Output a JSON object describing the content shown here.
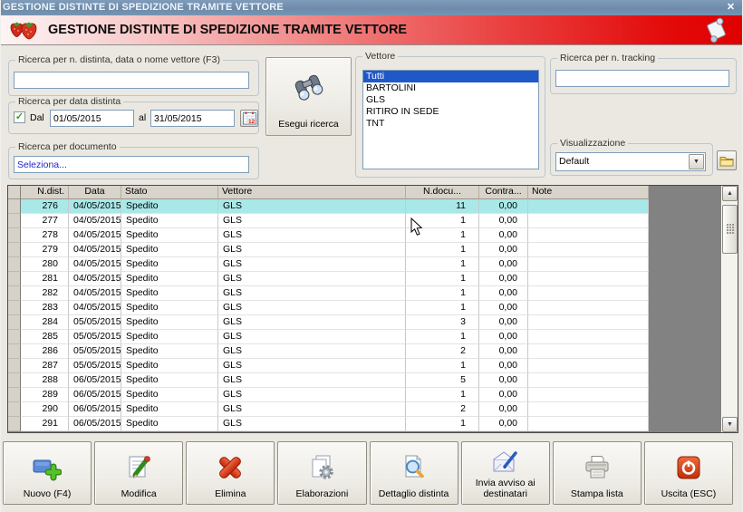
{
  "titlebar": {
    "title": "GESTIONE DISTINTE DI SPEDIZIONE TRAMITE VETTORE",
    "close_glyph": "✕"
  },
  "header": {
    "title": "GESTIONE DISTINTE DI SPEDIZIONE TRAMITE VETTORE"
  },
  "search": {
    "distinta": {
      "label": "Ricerca per n. distinta, data o nome vettore (F3)",
      "value": ""
    },
    "date": {
      "label": "Ricerca per data distinta",
      "checkbox_checked": true,
      "from_label": "Dal",
      "from_value": "01/05/2015",
      "to_label": "al",
      "to_value": "31/05/2015"
    },
    "documento": {
      "label": "Ricerca per documento",
      "value": "Seleziona..."
    },
    "esegui_label": "Esegui ricerca",
    "vettore": {
      "label": "Vettore",
      "items": [
        "Tutti",
        "BARTOLINI",
        "GLS",
        "RITIRO IN SEDE",
        "TNT"
      ],
      "selected": "Tutti"
    },
    "tracking": {
      "label": "Ricerca per n. tracking",
      "value": ""
    },
    "visualizzazione": {
      "label": "Visualizzazione",
      "value": "Default"
    }
  },
  "grid": {
    "columns": [
      "N.dist.",
      "Data",
      "Stato",
      "Vettore",
      "N.docu...",
      "Contra...",
      "Note"
    ],
    "selected_row": 0,
    "rows": [
      [
        "276",
        "04/05/2015",
        "Spedito",
        "GLS",
        "11",
        "0,00",
        ""
      ],
      [
        "277",
        "04/05/2015",
        "Spedito",
        "GLS",
        "1",
        "0,00",
        ""
      ],
      [
        "278",
        "04/05/2015",
        "Spedito",
        "GLS",
        "1",
        "0,00",
        ""
      ],
      [
        "279",
        "04/05/2015",
        "Spedito",
        "GLS",
        "1",
        "0,00",
        ""
      ],
      [
        "280",
        "04/05/2015",
        "Spedito",
        "GLS",
        "1",
        "0,00",
        ""
      ],
      [
        "281",
        "04/05/2015",
        "Spedito",
        "GLS",
        "1",
        "0,00",
        ""
      ],
      [
        "282",
        "04/05/2015",
        "Spedito",
        "GLS",
        "1",
        "0,00",
        ""
      ],
      [
        "283",
        "04/05/2015",
        "Spedito",
        "GLS",
        "1",
        "0,00",
        ""
      ],
      [
        "284",
        "05/05/2015",
        "Spedito",
        "GLS",
        "3",
        "0,00",
        ""
      ],
      [
        "285",
        "05/05/2015",
        "Spedito",
        "GLS",
        "1",
        "0,00",
        ""
      ],
      [
        "286",
        "05/05/2015",
        "Spedito",
        "GLS",
        "2",
        "0,00",
        ""
      ],
      [
        "287",
        "05/05/2015",
        "Spedito",
        "GLS",
        "1",
        "0,00",
        ""
      ],
      [
        "288",
        "06/05/2015",
        "Spedito",
        "GLS",
        "5",
        "0,00",
        ""
      ],
      [
        "289",
        "06/05/2015",
        "Spedito",
        "GLS",
        "1",
        "0,00",
        ""
      ],
      [
        "290",
        "06/05/2015",
        "Spedito",
        "GLS",
        "2",
        "0,00",
        ""
      ],
      [
        "291",
        "06/05/2015",
        "Spedito",
        "GLS",
        "1",
        "0,00",
        ""
      ]
    ]
  },
  "toolbar": {
    "buttons": [
      {
        "label": "Nuovo (F4)",
        "icon": "new-icon"
      },
      {
        "label": "Modifica",
        "icon": "edit-icon"
      },
      {
        "label": "Elimina",
        "icon": "delete-icon"
      },
      {
        "label": "Elaborazioni",
        "icon": "process-icon"
      },
      {
        "label": "Dettaglio distinta",
        "icon": "detail-icon"
      },
      {
        "label": "Invia avviso ai destinatari",
        "icon": "send-notice-icon"
      },
      {
        "label": "Stampa lista",
        "icon": "print-icon"
      },
      {
        "label": "Uscita (ESC)",
        "icon": "exit-icon"
      }
    ]
  },
  "icons": {
    "check": "✓",
    "combo_arrow": "▼",
    "scroll_up": "▲",
    "scroll_down": "▼"
  },
  "colors": {
    "titlebar_blue": "#6D8BAA",
    "header_red": "#E00000",
    "selected_row_cyan": "#A9E8E8",
    "list_selection_blue": "#2058C8",
    "form_background": "#EBE8E2",
    "grid_filler_gray": "#828282"
  }
}
